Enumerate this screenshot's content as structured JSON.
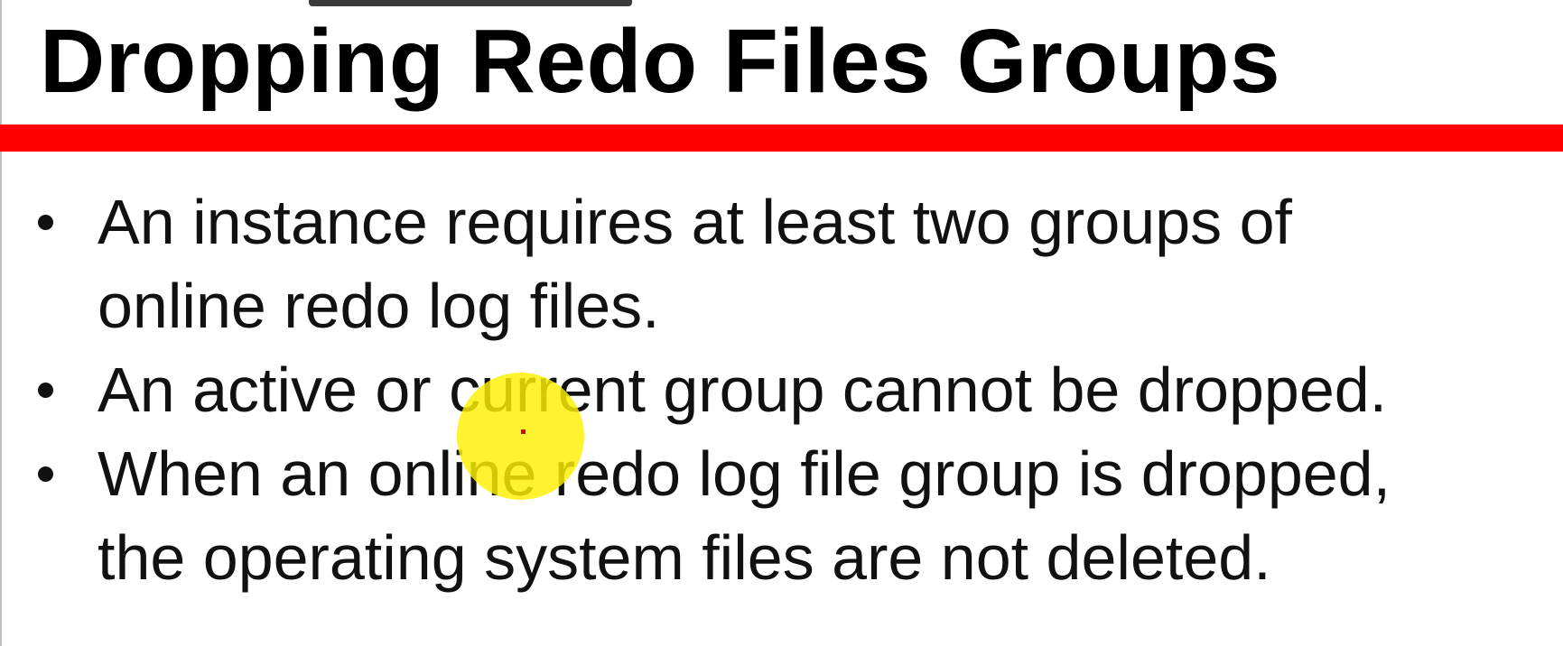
{
  "slide": {
    "title": "Dropping Redo Files Groups",
    "bullets": [
      {
        "lines": [
          "An instance requires at least two groups of",
          "online redo log files."
        ]
      },
      {
        "lines": [
          "An active or current group cannot be dropped."
        ]
      },
      {
        "lines": [
          "When an online redo log file group is dropped,",
          "the operating system files are not deleted."
        ]
      }
    ]
  },
  "colors": {
    "accent_rule": "#ff0000",
    "cursor_highlight": "#fff000",
    "background": "#ffffff",
    "text": "#111111"
  }
}
